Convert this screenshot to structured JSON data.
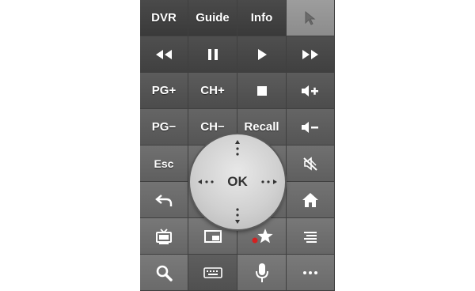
{
  "remote": {
    "row0": {
      "dvr": "DVR",
      "guide": "Guide",
      "info": "Info"
    },
    "row2": {
      "pg_plus": "PG+",
      "ch_plus": "CH+"
    },
    "row3": {
      "pg_minus": "PG−",
      "ch_minus": "CH−",
      "recall": "Recall"
    },
    "row4": {
      "esc": "Esc"
    },
    "dpad": {
      "ok": "OK"
    }
  },
  "colors": {
    "accent_red": "#d42020"
  }
}
